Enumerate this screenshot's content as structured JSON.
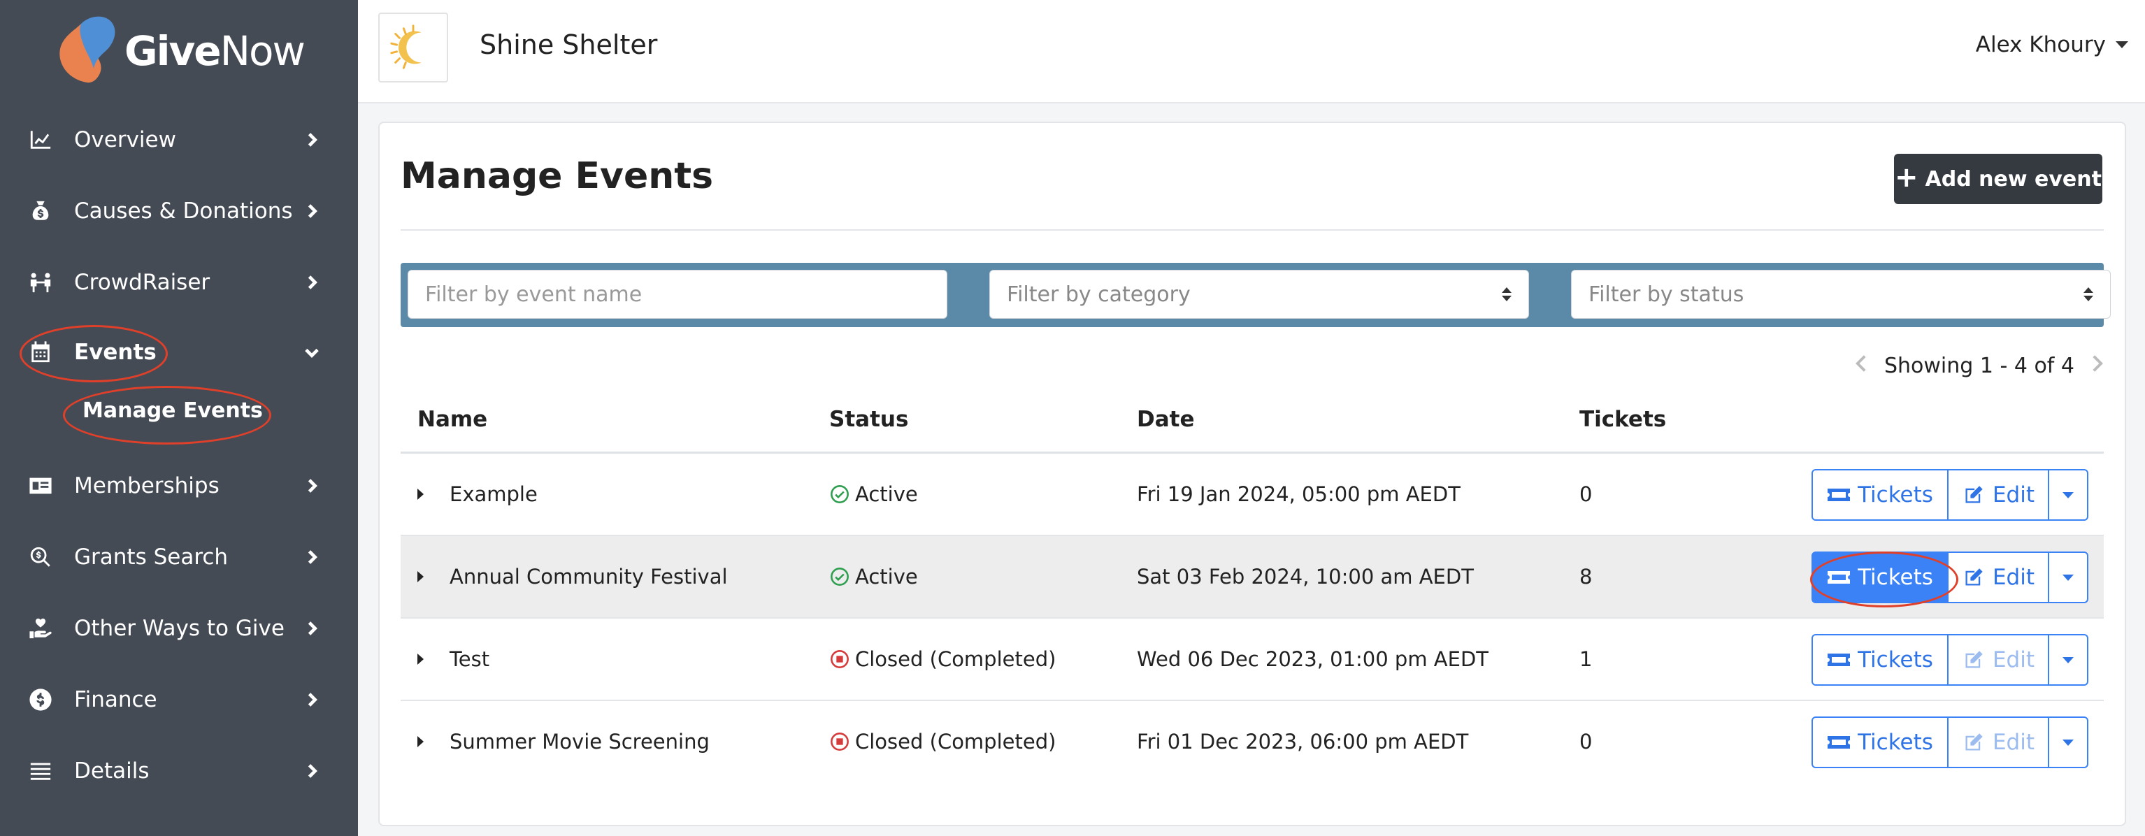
{
  "brand": {
    "logo_give": "Give",
    "logo_now": "Now",
    "accent": "#3b82f6",
    "highlight_ring": "#e0402a"
  },
  "sidebar": {
    "items": [
      {
        "label": "Overview",
        "icon": "chart-line-icon"
      },
      {
        "label": "Causes & Donations",
        "icon": "donation-bag-icon"
      },
      {
        "label": "CrowdRaiser",
        "icon": "people-link-icon"
      },
      {
        "label": "Events",
        "icon": "calendar-icon",
        "expanded": true
      },
      {
        "label": "Memberships",
        "icon": "id-card-icon"
      },
      {
        "label": "Grants Search",
        "icon": "search-dollar-icon"
      },
      {
        "label": "Other Ways to Give",
        "icon": "hand-heart-icon"
      },
      {
        "label": "Finance",
        "icon": "coin-dollar-icon"
      },
      {
        "label": "Details",
        "icon": "list-icon"
      }
    ],
    "sub_item": "Manage Events"
  },
  "header": {
    "org_name": "Shine Shelter",
    "user_name": "Alex Khoury"
  },
  "main": {
    "title": "Manage Events",
    "add_button": "Add new event",
    "filters": {
      "name_placeholder": "Filter by event name",
      "category_placeholder": "Filter by category",
      "status_placeholder": "Filter by status"
    },
    "pagination": "Showing 1 - 4 of 4",
    "columns": [
      "Name",
      "Status",
      "Date",
      "Tickets"
    ],
    "rows": [
      {
        "name": "Example",
        "status": "Active",
        "status_kind": "active",
        "date": "Fri 19 Jan 2024, 05:00 pm AEDT",
        "tickets": "0",
        "edit_enabled": true
      },
      {
        "name": "Annual Community Festival",
        "status": "Active",
        "status_kind": "active",
        "date": "Sat 03 Feb 2024, 10:00 am AEDT",
        "tickets": "8",
        "edit_enabled": true
      },
      {
        "name": "Test",
        "status": "Closed (Completed)",
        "status_kind": "closed",
        "date": "Wed 06 Dec 2023, 01:00 pm AEDT",
        "tickets": "1",
        "edit_enabled": false
      },
      {
        "name": "Summer Movie Screening",
        "status": "Closed (Completed)",
        "status_kind": "closed",
        "date": "Fri 01 Dec 2023, 06:00 pm AEDT",
        "tickets": "0",
        "edit_enabled": false
      }
    ],
    "tickets_button": "Tickets",
    "edit_button": "Edit"
  }
}
